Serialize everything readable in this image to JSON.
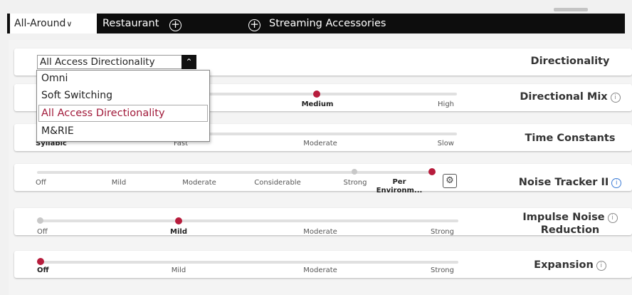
{
  "tabs": {
    "active": "All-Around",
    "restaurant": "Restaurant",
    "streaming": "Streaming Accessories"
  },
  "directionality": {
    "label": "Directionality",
    "selected": "All Access Directionality",
    "options": [
      "Omni",
      "Soft Switching",
      "All Access Directionality",
      "M&RIE"
    ]
  },
  "directional_mix": {
    "label": "Directional Mix",
    "ticks": [
      "Medium",
      "High"
    ],
    "selected": "Medium"
  },
  "time_constants": {
    "label": "Time Constants",
    "ticks": [
      "Syllabic",
      "Fast",
      "Moderate",
      "Slow"
    ]
  },
  "noise_tracker": {
    "label": "Noise Tracker II",
    "ticks": [
      "Off",
      "Mild",
      "Moderate",
      "Considerable",
      "Strong",
      "Per",
      "Environm..."
    ],
    "selected": "Per Environment"
  },
  "impulse_noise": {
    "label_line1": "Impulse Noise",
    "label_line2": "Reduction",
    "ticks": [
      "Off",
      "Mild",
      "Moderate",
      "Strong"
    ],
    "selected": "Mild"
  },
  "expansion": {
    "label": "Expansion",
    "ticks": [
      "Off",
      "Mild",
      "Moderate",
      "Strong"
    ],
    "selected": "Off"
  },
  "colors": {
    "accent": "#b71c3c",
    "tabbar": "#0d0d0d",
    "info_blue": "#3a7bd5"
  },
  "icons": {
    "info": "info-icon",
    "settings": "gear-icon",
    "add": "plus-circle-icon",
    "chevron": "chevron-down-icon"
  }
}
